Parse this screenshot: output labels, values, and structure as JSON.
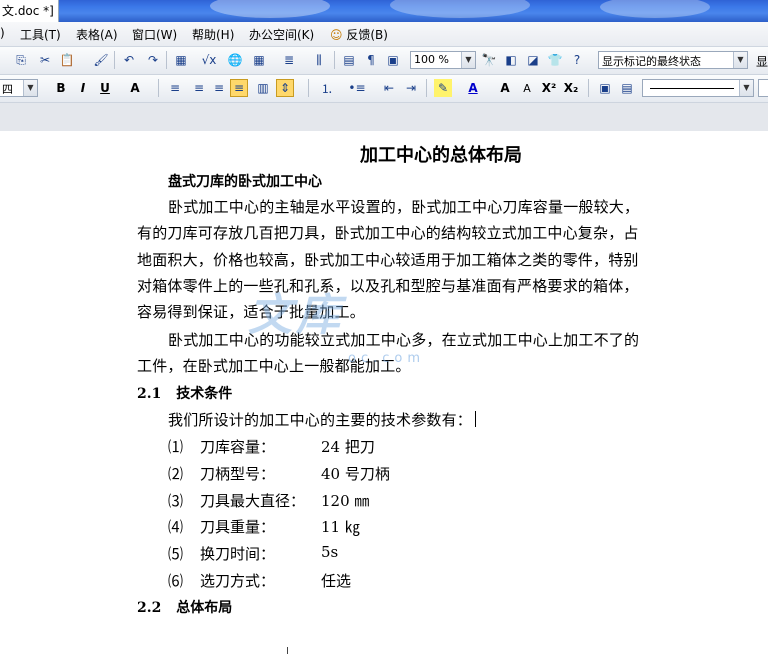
{
  "window": {
    "title": "文.doc *]"
  },
  "menu": [
    ")",
    "工具(T)",
    "表格(A)",
    "窗口(W)",
    "帮助(H)",
    "办公空间(K)",
    "反馈(B)"
  ],
  "toolbar1": {
    "zoom": "100 %",
    "markup_mode": "显示标记的最终状态",
    "markup_right_label": "显"
  },
  "toolbar2": {
    "font_size": "四",
    "bold": "B",
    "italic": "I",
    "underline": "U",
    "font_a": "A",
    "grow_font": "A",
    "shrink_font": "A",
    "superscript": "X²",
    "subscript": "X₂"
  },
  "document": {
    "title": "加工中心的总体布局",
    "subtitle": "盘式刀库的卧式加工中心",
    "para1": [
      "卧式加工中心的主轴是水平设置的，卧式加工中心刀库容量一般较大，",
      "有的刀库可存放几百把刀具，卧式加工中心的结构较立式加工中心复杂，占",
      "地面积大，价格也较高，卧式加工中心较适用于加工箱体之类的零件，特别",
      "对箱体零件上的一些孔和孔系，以及孔和型腔与基准面有严格要求的箱体，",
      "容易得到保证，适合于批量加工。"
    ],
    "para2": [
      "卧式加工中心的功能较立式加工中心多，在立式加工中心上加工不了的",
      "工件，在卧式加工中心上一般都能加工。"
    ],
    "section1": {
      "num": "2.1",
      "title": "技术条件"
    },
    "intro": "我们所设计的加工中心的主要的技术参数有：",
    "params": [
      {
        "idx": "⑴",
        "name": "刀库容量：",
        "value": "24 把刀"
      },
      {
        "idx": "⑵",
        "name": "刀柄型号：",
        "value": "40 号刀柄"
      },
      {
        "idx": "⑶",
        "name": "刀具最大直径：",
        "value": "120 ㎜"
      },
      {
        "idx": "⑷",
        "name": "刀具重量：",
        "value": "11 ㎏"
      },
      {
        "idx": "⑸",
        "name": "换刀时间：",
        "value": "5s"
      },
      {
        "idx": "⑹",
        "name": "选刀方式：",
        "value": "任选"
      }
    ],
    "section2": {
      "num": "2.2",
      "title": "总体布局"
    }
  },
  "watermark": {
    "main": "文库",
    "sub": "oc.com"
  }
}
